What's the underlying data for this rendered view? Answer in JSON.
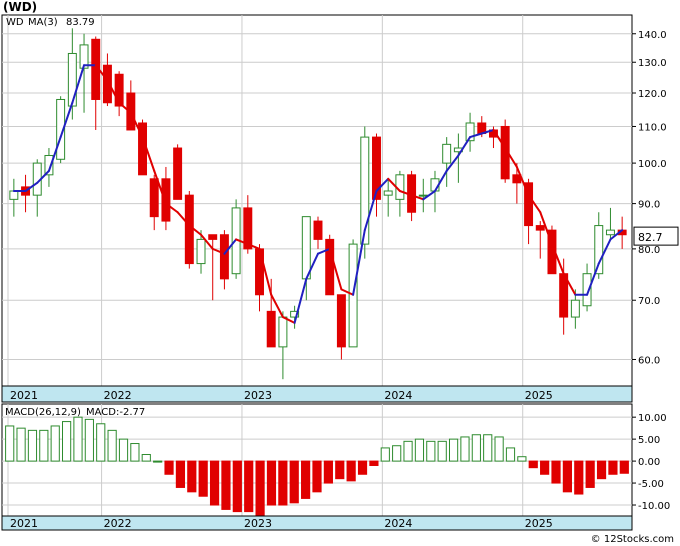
{
  "ticker": "(WD)",
  "watermark": "© 12Stocks.com",
  "colors": {
    "up": "#2e8b2e",
    "down": "#e00000",
    "ma": "#2020c0",
    "ma_down": "#e00000",
    "band": "#bfe6f0"
  },
  "chart_data": [
    {
      "type": "candlestick",
      "legend": {
        "symbol": "WD",
        "ma_label": "MA(3)",
        "ma_value": "83.79"
      },
      "last_price_tag": "82.7",
      "scale": "log",
      "ylim": [
        56,
        147
      ],
      "y_ticks": [
        60,
        70,
        80,
        90,
        100,
        110,
        120,
        130,
        140
      ],
      "y_tick_labels": [
        "60.0",
        "70.0",
        "80.0",
        "90.0",
        "100.0",
        "110.0",
        "120.0",
        "130.0",
        "140.0"
      ],
      "year_labels": [
        "2021",
        "2022",
        "2023",
        "2024",
        "2025"
      ],
      "year_index": [
        0,
        8,
        20,
        32,
        44
      ],
      "candles": [
        {
          "o": 91,
          "h": 96,
          "l": 87,
          "c": 93
        },
        {
          "o": 94,
          "h": 97,
          "l": 88,
          "c": 92
        },
        {
          "o": 92,
          "h": 101,
          "l": 87,
          "c": 100
        },
        {
          "o": 97,
          "h": 104,
          "l": 94,
          "c": 102
        },
        {
          "o": 101,
          "h": 119,
          "l": 100,
          "c": 118
        },
        {
          "o": 116,
          "h": 142,
          "l": 112,
          "c": 133
        },
        {
          "o": 128,
          "h": 140,
          "l": 114,
          "c": 136
        },
        {
          "o": 138,
          "h": 139,
          "l": 109,
          "c": 118
        },
        {
          "o": 129,
          "h": 133,
          "l": 116,
          "c": 117
        },
        {
          "o": 126,
          "h": 127,
          "l": 113,
          "c": 116
        },
        {
          "o": 120,
          "h": 124,
          "l": 109,
          "c": 109
        },
        {
          "o": 111,
          "h": 112,
          "l": 97,
          "c": 97
        },
        {
          "o": 96,
          "h": 97,
          "l": 84,
          "c": 87
        },
        {
          "o": 96,
          "h": 99,
          "l": 84,
          "c": 86
        },
        {
          "o": 104,
          "h": 105,
          "l": 91,
          "c": 91
        },
        {
          "o": 92,
          "h": 93,
          "l": 76,
          "c": 77
        },
        {
          "o": 77,
          "h": 84,
          "l": 75,
          "c": 82
        },
        {
          "o": 83,
          "h": 83,
          "l": 70,
          "c": 82
        },
        {
          "o": 83,
          "h": 84,
          "l": 72,
          "c": 74
        },
        {
          "o": 75,
          "h": 91,
          "l": 74,
          "c": 89
        },
        {
          "o": 89,
          "h": 92,
          "l": 79,
          "c": 80
        },
        {
          "o": 80,
          "h": 81,
          "l": 68,
          "c": 71
        },
        {
          "o": 68,
          "h": 74,
          "l": 62,
          "c": 62
        },
        {
          "o": 62,
          "h": 68,
          "l": 57,
          "c": 67
        },
        {
          "o": 67,
          "h": 69,
          "l": 65,
          "c": 68
        },
        {
          "o": 74,
          "h": 87,
          "l": 70,
          "c": 87
        },
        {
          "o": 86,
          "h": 87,
          "l": 80,
          "c": 82
        },
        {
          "o": 82,
          "h": 83,
          "l": 71,
          "c": 71
        },
        {
          "o": 71,
          "h": 71,
          "l": 60,
          "c": 62
        },
        {
          "o": 62,
          "h": 82,
          "l": 62,
          "c": 81
        },
        {
          "o": 81,
          "h": 110,
          "l": 78,
          "c": 107
        },
        {
          "o": 107,
          "h": 108,
          "l": 87,
          "c": 91
        },
        {
          "o": 92,
          "h": 96,
          "l": 87,
          "c": 93
        },
        {
          "o": 91,
          "h": 98,
          "l": 87,
          "c": 97
        },
        {
          "o": 97,
          "h": 98,
          "l": 86,
          "c": 88
        },
        {
          "o": 92,
          "h": 96,
          "l": 88,
          "c": 92
        },
        {
          "o": 93,
          "h": 98,
          "l": 88,
          "c": 96
        },
        {
          "o": 100,
          "h": 107,
          "l": 94,
          "c": 105
        },
        {
          "o": 103,
          "h": 108,
          "l": 95,
          "c": 104
        },
        {
          "o": 106,
          "h": 114,
          "l": 103,
          "c": 111
        },
        {
          "o": 111,
          "h": 113,
          "l": 107,
          "c": 108
        },
        {
          "o": 109,
          "h": 110,
          "l": 104,
          "c": 107
        },
        {
          "o": 110,
          "h": 112,
          "l": 95,
          "c": 96
        },
        {
          "o": 97,
          "h": 100,
          "l": 90,
          "c": 95
        },
        {
          "o": 95,
          "h": 96,
          "l": 81,
          "c": 85
        },
        {
          "o": 85,
          "h": 86,
          "l": 78,
          "c": 84
        },
        {
          "o": 84,
          "h": 85,
          "l": 75,
          "c": 75
        },
        {
          "o": 75,
          "h": 78,
          "l": 64,
          "c": 67
        },
        {
          "o": 67,
          "h": 72,
          "l": 65,
          "c": 70
        },
        {
          "o": 69,
          "h": 77,
          "l": 68,
          "c": 75
        },
        {
          "o": 75,
          "h": 88,
          "l": 74,
          "c": 85
        },
        {
          "o": 83,
          "h": 89,
          "l": 82,
          "c": 84
        },
        {
          "o": 84,
          "h": 87,
          "l": 80,
          "c": 83
        }
      ],
      "ma": [
        93,
        93,
        95,
        98,
        107,
        117,
        129,
        129,
        124,
        117,
        114,
        107,
        98,
        90,
        88,
        85,
        83,
        80,
        79,
        82,
        81,
        80,
        71,
        67,
        66,
        74,
        79,
        80,
        72,
        71,
        84,
        93,
        96,
        93,
        92,
        91,
        93,
        98,
        102,
        107,
        108,
        109,
        104,
        99,
        92,
        88,
        81,
        75,
        71,
        71,
        77,
        82,
        84
      ]
    },
    {
      "type": "bar",
      "legend": {
        "label": "MACD(26,12,9)",
        "value_label": "MACD:-2.77"
      },
      "ylim": [
        -12.5,
        13
      ],
      "y_ticks": [
        -10,
        -5,
        0,
        5,
        10
      ],
      "y_tick_labels": [
        "-10.00",
        "-5.00",
        "0.00",
        "5.00",
        "10.00"
      ],
      "year_labels": [
        "2021",
        "2022",
        "2023",
        "2024",
        "2025"
      ],
      "values": [
        8,
        7.5,
        7,
        7,
        8,
        9,
        10,
        9.5,
        8.5,
        7,
        5,
        4,
        1.5,
        0,
        -3,
        -6,
        -7,
        -8,
        -10,
        -11,
        -11.5,
        -11.5,
        -12.5,
        -10,
        -10,
        -9.5,
        -8.5,
        -7,
        -5,
        -4,
        -4.5,
        -3,
        -1,
        3,
        3.5,
        4.5,
        5,
        4.5,
        4.5,
        5,
        5.5,
        6,
        6,
        5.5,
        3,
        1,
        -1.5,
        -3,
        -5,
        -7,
        -7.5,
        -6,
        -4,
        -3,
        -2.77
      ]
    }
  ]
}
